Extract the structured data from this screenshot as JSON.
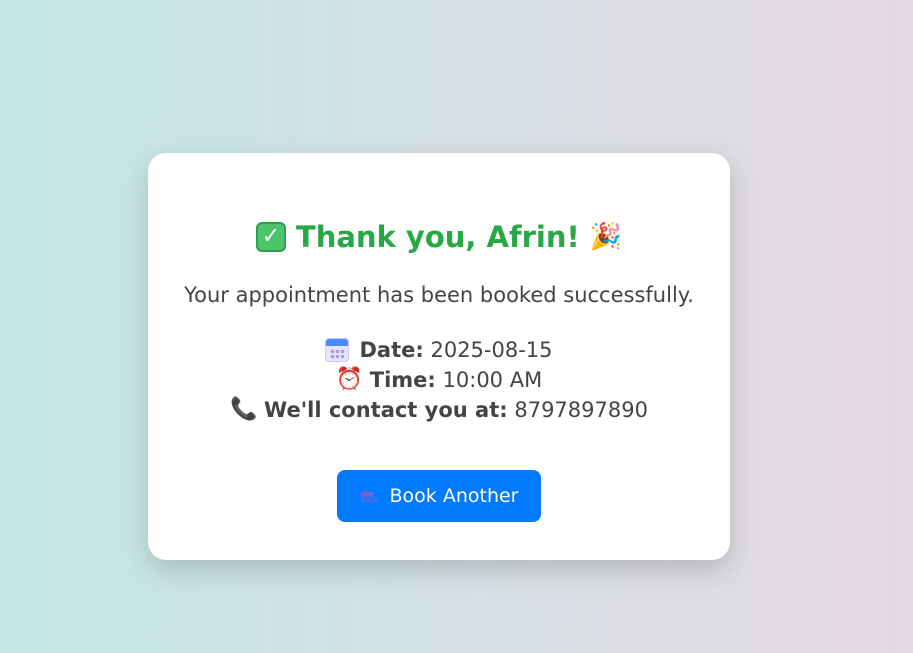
{
  "card": {
    "title": "Thank you, Afrin!",
    "title_icon_left": "check-mark-icon",
    "title_icon_right": "party-popper-icon",
    "subtitle": "Your appointment has been booked successfully.",
    "details": {
      "date_label": "Date:",
      "date_value": "2025-08-15",
      "time_label": "Time:",
      "time_value": "10:00 AM",
      "contact_label": "We'll contact you at:",
      "contact_value": "8797897890"
    },
    "button_label": "Book Another"
  },
  "colors": {
    "title": "#28a745",
    "button": "#007bff",
    "text": "#444444"
  }
}
